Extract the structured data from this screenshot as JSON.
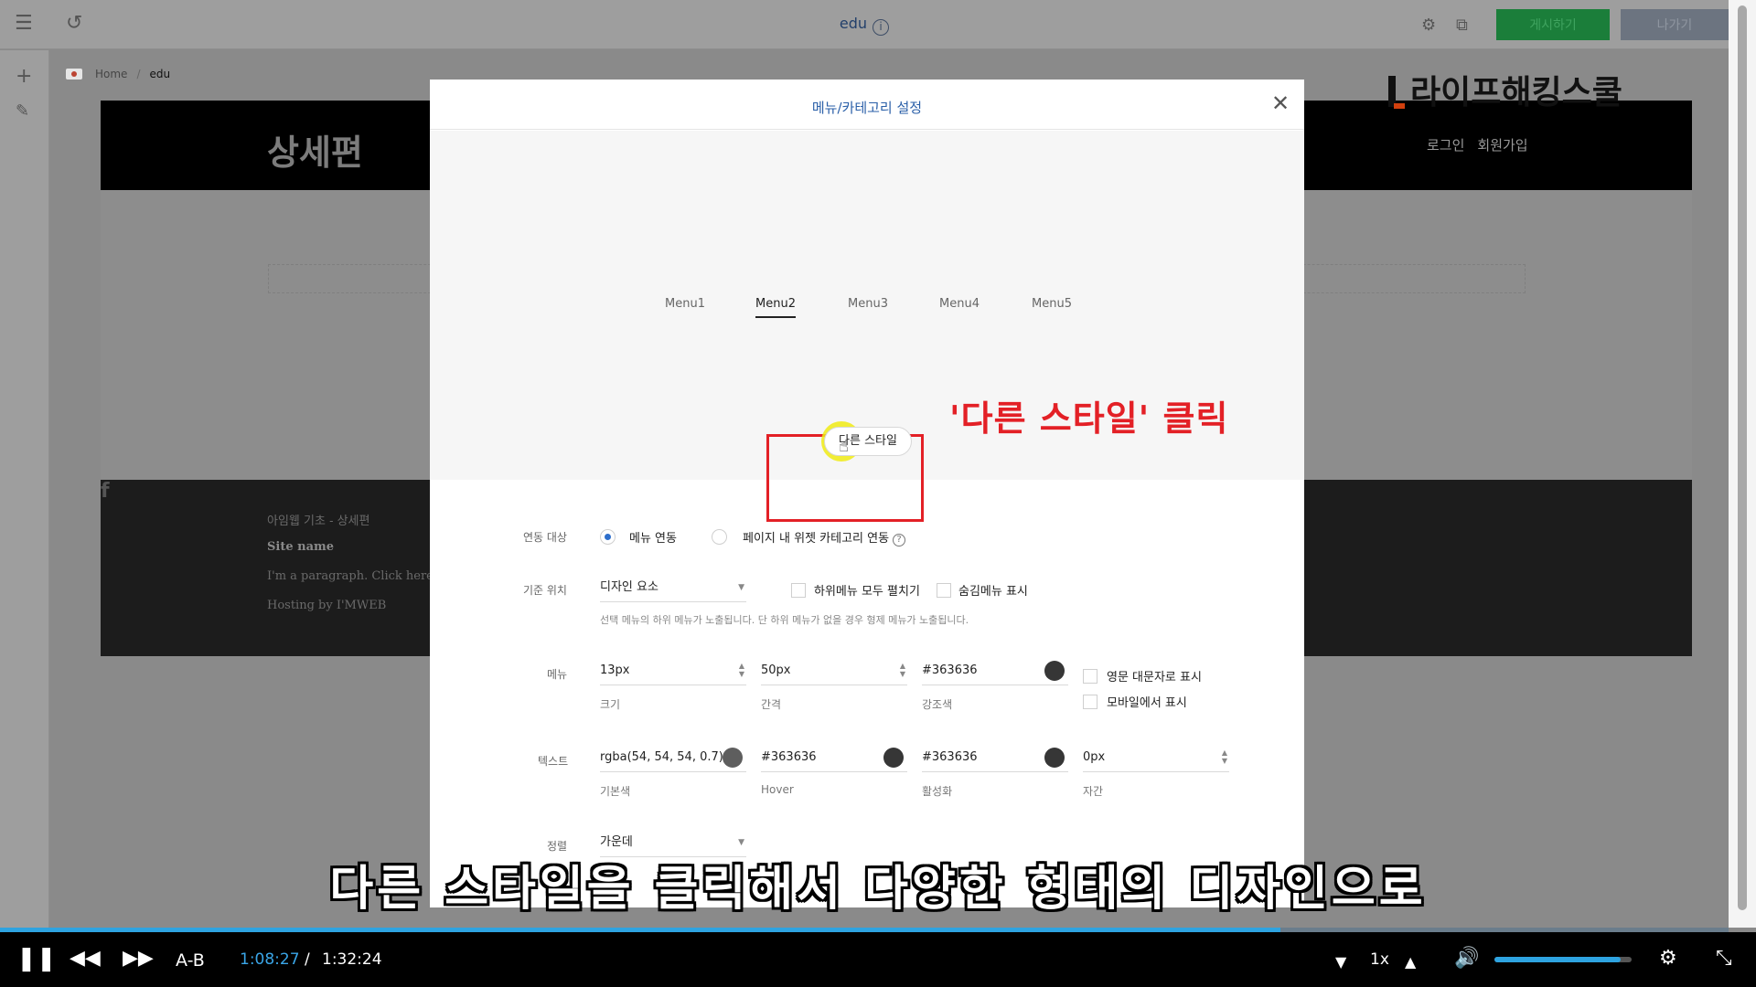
{
  "editor": {
    "page_title": "edu",
    "publish_label": "게시하기",
    "exit_label": "나가기"
  },
  "breadcrumb": [
    "Home",
    "edu"
  ],
  "site": {
    "brand": "상세편",
    "logo_text": "라이프해킹스쿨",
    "header_links": [
      "로그인",
      "회원가입"
    ],
    "footer": [
      "아임웹 기초 - 상세편",
      "Site name",
      "I'm a paragraph. Click here t",
      "Hosting by I'MWEB"
    ]
  },
  "modal": {
    "title": "메뉴/카테고리 설정",
    "preview_menus": [
      "Menu1",
      "Menu2",
      "Menu3",
      "Menu4",
      "Menu5"
    ],
    "active_menu": "Menu2",
    "style_button": "다른 스타일",
    "annotation": "'다른 스타일' 클릭",
    "link_target": {
      "label": "연동 대상",
      "options": [
        "메뉴 연동",
        "페이지 내 위젯 카테고리 연동"
      ],
      "selected": 0
    },
    "base_position": {
      "label": "기준 위치",
      "value": "디자인 요소",
      "checkboxes": [
        "하위메뉴 모두 펼치기",
        "숨김메뉴 표시"
      ],
      "hint": "선택 메뉴의 하위 메뉴가 노출됩니다. 단 하위 메뉴가 없을 경우 형제 메뉴가 노출됩니다."
    },
    "menu": {
      "label": "메뉴",
      "size": {
        "value": "13px",
        "sub": "크기"
      },
      "gap": {
        "value": "50px",
        "sub": "간격"
      },
      "accent": {
        "value": "#363636",
        "sub": "강조색",
        "color": "#363636"
      },
      "checkboxes": [
        "영문 대문자로 표시",
        "모바일에서 표시"
      ]
    },
    "text": {
      "label": "텍스트",
      "base": {
        "value": "rgba(54, 54, 54, 0.7)",
        "sub": "기본색",
        "color": "#5e5e5e"
      },
      "hover": {
        "value": "#363636",
        "sub": "Hover",
        "color": "#363636"
      },
      "active": {
        "value": "#363636",
        "sub": "활성화",
        "color": "#363636"
      },
      "spacing": {
        "value": "0px",
        "sub": "자간"
      }
    },
    "align": {
      "label": "정렬",
      "value": "가운데"
    }
  },
  "subtitle": "다른 스타일을 클릭해서 다양한 형태의 디자인으로",
  "player": {
    "ab_label": "A-B",
    "current_time": "1:08:27",
    "separator": "/",
    "total_time": "1:32:24",
    "speed": "1x",
    "progress": 0.741,
    "volume": 0.92
  },
  "colors": {
    "accent_blue": "#2ea3e0",
    "annotation_red": "#e32026",
    "publish_green": "#1b7e3a"
  }
}
